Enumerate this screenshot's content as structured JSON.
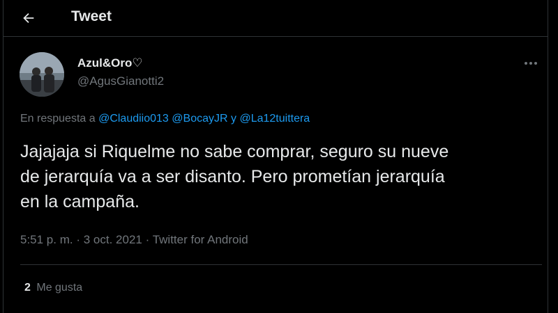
{
  "header": {
    "title": "Tweet",
    "back_icon": "arrow-left-icon"
  },
  "tweet": {
    "display_name": "Azul&Oro♡",
    "handle": "@AgusGianotti2",
    "reply_prefix": "En respuesta a",
    "mentions": [
      "@Claudiio013",
      "@BocayJR"
    ],
    "reply_conjunction": "y",
    "last_mention": "@La12tuittera",
    "text_lines": [
      "Jajajaja si Riquelme no sabe comprar, seguro su nueve",
      "de jerarquía va a ser disanto. Pero prometían jerarquía",
      "en la campaña."
    ],
    "time": "5:51 p. m.",
    "separator": "·",
    "date": "3 oct. 2021",
    "source": "Twitter for Android",
    "likes_count": "2",
    "likes_label": "Me gusta",
    "more_icon": "more-horizontal-icon"
  },
  "colors": {
    "background": "#000000",
    "text": "#e7e9ea",
    "secondary_text": "#71767b",
    "accent": "#1d9bf0",
    "border": "#2f3336"
  }
}
